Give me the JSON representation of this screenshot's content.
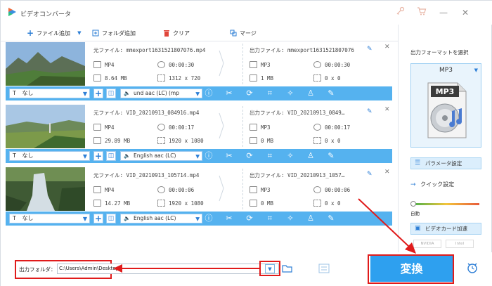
{
  "window": {
    "title": "ビデオコンバータ"
  },
  "toolbar": {
    "add_file": "ファイル追加",
    "add_folder": "フォルダ追加",
    "clear": "クリア",
    "merge": "マージ"
  },
  "files": [
    {
      "src_name": "元ファイル: mmexport1631521807076.mp4",
      "src_format": "MP4",
      "src_duration": "00:00:30",
      "src_size": "8.64 MB",
      "src_res": "1312 x 720",
      "out_name": "出力ファイル: mmexport1631521807076",
      "out_format": "MP3",
      "out_duration": "00:00:30",
      "out_size": "1 MB",
      "out_res": "0 x 0",
      "subtitle": "なし",
      "audio": "und aac (LC) (mp"
    },
    {
      "src_name": "元ファイル: VID_20210913_084916.mp4",
      "src_format": "MP4",
      "src_duration": "00:00:17",
      "src_size": "29.89 MB",
      "src_res": "1920 x 1080",
      "out_name": "出力ファイル: VID_20210913_0849…",
      "out_format": "MP3",
      "out_duration": "00:00:17",
      "out_size": "0 MB",
      "out_res": "0 x 0",
      "subtitle": "なし",
      "audio": "English aac (LC)"
    },
    {
      "src_name": "元ファイル: VID_20210913_105714.mp4",
      "src_format": "MP4",
      "src_duration": "00:00:06",
      "src_size": "14.27 MB",
      "src_res": "1920 x 1080",
      "out_name": "出力ファイル: VID_20210913_1057…",
      "out_format": "MP3",
      "out_duration": "00:00:06",
      "out_size": "0 MB",
      "out_res": "0 x 0",
      "subtitle": "なし",
      "audio": "English aac (LC)"
    }
  ],
  "right_panel": {
    "format_label": "出力フォーマットを選択",
    "format_name": "MP3",
    "format_icon_text": "MP3",
    "params_button": "パラメータ設定",
    "quick_label": "クイック設定",
    "auto_label": "自動",
    "gpu_button": "ビデオカード加速",
    "nvidia": "NVIDIA",
    "intel": "Intel"
  },
  "bottom": {
    "output_folder_label": "出力フォルダ：",
    "output_path": "C:\\Users\\Admin\\Desktop",
    "convert_label": "変換"
  },
  "colors": {
    "accent": "#2ea0ef",
    "option_bar": "#55b2ef",
    "annotation": "#e01b1b"
  }
}
